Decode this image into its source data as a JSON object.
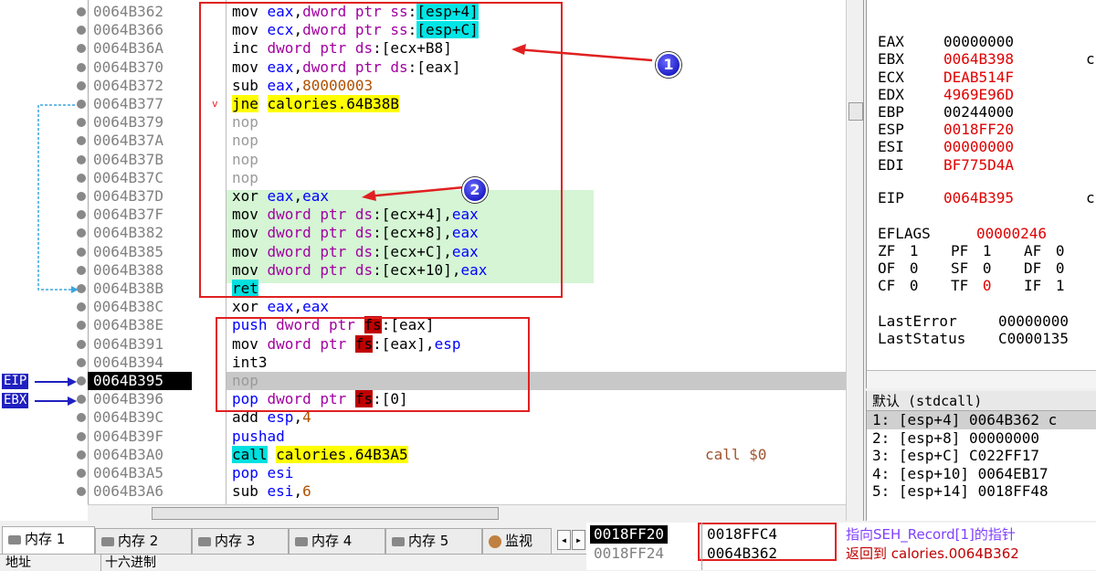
{
  "disasm": {
    "rows": [
      {
        "addr": "0064B362",
        "parts": [
          [
            "kw",
            "mov "
          ],
          [
            "reg",
            "eax"
          ],
          [
            "kw",
            ","
          ],
          [
            "ptr",
            "dword ptr "
          ],
          [
            "seg",
            "ss"
          ],
          [
            "kw",
            ":"
          ],
          [
            "hilite",
            "[esp+4]"
          ]
        ]
      },
      {
        "addr": "0064B366",
        "parts": [
          [
            "kw",
            "mov "
          ],
          [
            "reg",
            "ecx"
          ],
          [
            "kw",
            ","
          ],
          [
            "ptr",
            "dword ptr "
          ],
          [
            "seg",
            "ss"
          ],
          [
            "kw",
            ":"
          ],
          [
            "hilite",
            "[esp+C]"
          ]
        ]
      },
      {
        "addr": "0064B36A",
        "parts": [
          [
            "kw",
            "inc "
          ],
          [
            "ptr",
            "dword ptr "
          ],
          [
            "seg",
            "ds"
          ],
          [
            "kw",
            ":[ecx+B8]"
          ]
        ]
      },
      {
        "addr": "0064B370",
        "parts": [
          [
            "kw",
            "mov "
          ],
          [
            "reg",
            "eax"
          ],
          [
            "kw",
            ","
          ],
          [
            "ptr",
            "dword ptr "
          ],
          [
            "seg",
            "ds"
          ],
          [
            "kw",
            ":[eax]"
          ]
        ]
      },
      {
        "addr": "0064B372",
        "parts": [
          [
            "kw",
            "sub "
          ],
          [
            "reg",
            "eax"
          ],
          [
            "kw",
            ","
          ],
          [
            "num",
            "80000003"
          ]
        ]
      },
      {
        "addr": "0064B377",
        "parts": [
          [
            "jmp",
            "jne"
          ],
          [
            "kw",
            " "
          ],
          [
            "lbl",
            "calories.64B38B"
          ]
        ],
        "arrow": "v"
      },
      {
        "addr": "0064B379",
        "parts": [
          [
            "nop",
            "nop"
          ]
        ]
      },
      {
        "addr": "0064B37A",
        "parts": [
          [
            "nop",
            "nop"
          ]
        ]
      },
      {
        "addr": "0064B37B",
        "parts": [
          [
            "nop",
            "nop"
          ]
        ]
      },
      {
        "addr": "0064B37C",
        "parts": [
          [
            "nop",
            "nop"
          ]
        ]
      },
      {
        "addr": "0064B37D",
        "parts": [
          [
            "kw",
            "xor "
          ],
          [
            "reg",
            "eax"
          ],
          [
            "kw",
            ","
          ],
          [
            "reg",
            "eax"
          ]
        ]
      },
      {
        "addr": "0064B37F",
        "parts": [
          [
            "kw",
            "mov "
          ],
          [
            "ptr",
            "dword ptr "
          ],
          [
            "seg",
            "ds"
          ],
          [
            "kw",
            ":[ecx+4],"
          ],
          [
            "reg",
            "eax"
          ]
        ]
      },
      {
        "addr": "0064B382",
        "parts": [
          [
            "kw",
            "mov "
          ],
          [
            "ptr",
            "dword ptr "
          ],
          [
            "seg",
            "ds"
          ],
          [
            "kw",
            ":[ecx+8],"
          ],
          [
            "reg",
            "eax"
          ]
        ]
      },
      {
        "addr": "0064B385",
        "parts": [
          [
            "kw",
            "mov "
          ],
          [
            "ptr",
            "dword ptr "
          ],
          [
            "seg",
            "ds"
          ],
          [
            "kw",
            ":[ecx+C],"
          ],
          [
            "reg",
            "eax"
          ]
        ]
      },
      {
        "addr": "0064B388",
        "parts": [
          [
            "kw",
            "mov "
          ],
          [
            "ptr",
            "dword ptr "
          ],
          [
            "seg",
            "ds"
          ],
          [
            "kw",
            ":[ecx+10],"
          ],
          [
            "reg",
            "eax"
          ]
        ]
      },
      {
        "addr": "0064B38B",
        "parts": [
          [
            "ret",
            "ret"
          ]
        ]
      },
      {
        "addr": "0064B38C",
        "parts": [
          [
            "kw",
            "xor "
          ],
          [
            "reg",
            "eax"
          ],
          [
            "kw",
            ","
          ],
          [
            "reg",
            "eax"
          ]
        ]
      },
      {
        "addr": "0064B38E",
        "parts": [
          [
            "push",
            "push "
          ],
          [
            "ptr",
            "dword ptr "
          ],
          [
            "segfs",
            "fs"
          ],
          [
            "kw",
            ":[eax]"
          ]
        ]
      },
      {
        "addr": "0064B391",
        "parts": [
          [
            "kw",
            "mov "
          ],
          [
            "ptr",
            "dword ptr "
          ],
          [
            "segfs",
            "fs"
          ],
          [
            "kw",
            ":[eax],"
          ],
          [
            "reg",
            "esp"
          ]
        ]
      },
      {
        "addr": "0064B394",
        "parts": [
          [
            "kw",
            "int3"
          ]
        ]
      },
      {
        "addr": "0064B395",
        "parts": [
          [
            "nop",
            "nop"
          ]
        ],
        "current": true
      },
      {
        "addr": "0064B396",
        "parts": [
          [
            "push",
            "pop "
          ],
          [
            "ptr",
            "dword ptr "
          ],
          [
            "segfs",
            "fs"
          ],
          [
            "kw",
            ":[0]"
          ]
        ]
      },
      {
        "addr": "0064B39C",
        "parts": [
          [
            "kw",
            "add "
          ],
          [
            "reg",
            "esp"
          ],
          [
            "kw",
            ","
          ],
          [
            "num",
            "4"
          ]
        ]
      },
      {
        "addr": "0064B39F",
        "parts": [
          [
            "push",
            "pushad"
          ]
        ]
      },
      {
        "addr": "0064B3A0",
        "parts": [
          [
            "call",
            "call"
          ],
          [
            "kw",
            " "
          ],
          [
            "lbl",
            "calories.64B3A5"
          ]
        ],
        "comment": "call $0"
      },
      {
        "addr": "0064B3A5",
        "parts": [
          [
            "push",
            "pop "
          ],
          [
            "reg",
            "esi"
          ]
        ]
      },
      {
        "addr": "0064B3A6",
        "parts": [
          [
            "kw",
            "sub "
          ],
          [
            "reg",
            "esi"
          ],
          [
            "kw",
            ","
          ],
          [
            "num",
            "6"
          ]
        ]
      }
    ],
    "eip_label": "EIP",
    "ebx_label": "EBX",
    "badge1": "1",
    "badge2": "2"
  },
  "registers": [
    {
      "name": "EAX",
      "value": "00000000",
      "changed": false
    },
    {
      "name": "EBX",
      "value": "0064B398",
      "changed": true,
      "tail": "c"
    },
    {
      "name": "ECX",
      "value": "DEAB514F",
      "changed": true
    },
    {
      "name": "EDX",
      "value": "4969E96D",
      "changed": true
    },
    {
      "name": "EBP",
      "value": "00244000",
      "changed": false
    },
    {
      "name": "ESP",
      "value": "0018FF20",
      "changed": true
    },
    {
      "name": "ESI",
      "value": "00000000",
      "changed": true
    },
    {
      "name": "EDI",
      "value": "BF775D4A",
      "changed": true
    },
    {
      "name": "EIP",
      "value": "0064B395",
      "changed": true,
      "tail": "c"
    }
  ],
  "eflags": {
    "label": "EFLAGS",
    "value": "00000246"
  },
  "flags": [
    [
      [
        "ZF",
        "1",
        false
      ],
      [
        "PF",
        "1",
        false
      ],
      [
        "AF",
        "0",
        false
      ]
    ],
    [
      [
        "OF",
        "0",
        false
      ],
      [
        "SF",
        "0",
        false
      ],
      [
        "DF",
        "0",
        false
      ]
    ],
    [
      [
        "CF",
        "0",
        false
      ],
      [
        "TF",
        "0",
        true
      ],
      [
        "IF",
        "1",
        false
      ]
    ]
  ],
  "last_error": {
    "label": "LastError",
    "value": "00000000"
  },
  "last_status": {
    "label": "LastStatus",
    "value": "C0000135"
  },
  "callstack": {
    "header": "默认 (stdcall)",
    "lines": [
      "1: [esp+4] 0064B362 c",
      "2: [esp+8] 00000000",
      "3: [esp+C] C022FF17",
      "4: [esp+10] 0064EB17",
      "5: [esp+14] 0018FF48"
    ]
  },
  "tabs": [
    "内存 1",
    "内存 2",
    "内存 3",
    "内存 4",
    "内存 5",
    "监视"
  ],
  "mem_header": {
    "addr": "地址",
    "hex": "十六进制"
  },
  "stack": [
    {
      "addr": "0018FF20",
      "value": "0018FFC4",
      "comment": "指向SEH_Record[1]的指针",
      "selected": true
    },
    {
      "addr": "0018FF24",
      "value": "0064B362",
      "comment": "返回到 calories.0064B362",
      "selected": false
    }
  ],
  "colors": {
    "accent_red": "#e02020",
    "eip_blue": "#2020c0"
  }
}
